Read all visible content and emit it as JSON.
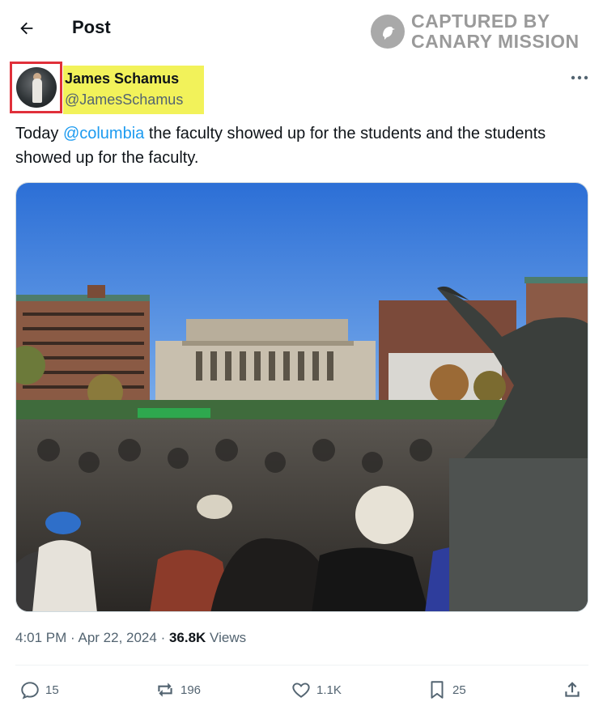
{
  "header": {
    "title": "Post",
    "back_icon": "arrow-left-icon"
  },
  "watermark": {
    "line1": "CAPTURED BY",
    "line2": "CANARY MISSION"
  },
  "author": {
    "display_name": "James Schamus",
    "handle": "@JamesSchamus"
  },
  "post": {
    "text_before": "Today ",
    "mention": "@columbia",
    "text_after": " the faculty showed up for the students and the students showed up for the faculty."
  },
  "meta": {
    "time": "4:01 PM",
    "sep1": " · ",
    "date": "Apr 22, 2024",
    "sep2": " · ",
    "views_count": "36.8K",
    "views_label": " Views"
  },
  "actions": {
    "replies": "15",
    "reposts": "196",
    "likes": "1.1K",
    "bookmarks": "25"
  },
  "colors": {
    "accent": "#1d9bf0",
    "text": "#0f1419",
    "muted": "#536471",
    "highlight": "#f2f25a",
    "avatar_border": "#e0303a"
  }
}
